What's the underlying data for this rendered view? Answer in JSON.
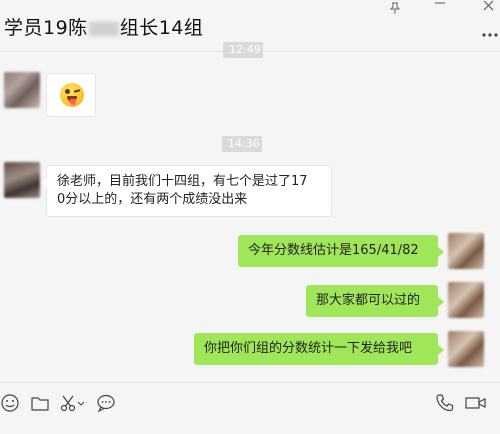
{
  "window": {
    "title_prefix": "学员19陈",
    "title_suffix": "组长14组"
  },
  "chat": {
    "timestamps": [
      "12:49",
      "14:36"
    ],
    "messages": [
      {
        "side": "in",
        "type": "emoji",
        "emoji_name": "tongue-out-wink-emoji"
      },
      {
        "side": "in",
        "type": "text",
        "lines": [
          "徐老师，目前我们十四组，有七个是过了17",
          "0分以上的，还有两个成绩没出来"
        ]
      },
      {
        "side": "out",
        "type": "text",
        "text": "今年分数线估计是165/41/82"
      },
      {
        "side": "out",
        "type": "text",
        "text": "那大家都可以过的"
      },
      {
        "side": "out",
        "type": "text",
        "text": "你把你们组的分数统计一下发给我吧"
      }
    ]
  },
  "toolbar": {
    "icons": [
      "emoji-icon",
      "folder-icon",
      "scissors-icon",
      "chat-history-icon",
      "phone-icon",
      "video-call-icon"
    ]
  },
  "colors": {
    "outgoing_bubble": "#9fe658",
    "incoming_bubble": "#ffffff",
    "background": "#f5f5f5"
  }
}
